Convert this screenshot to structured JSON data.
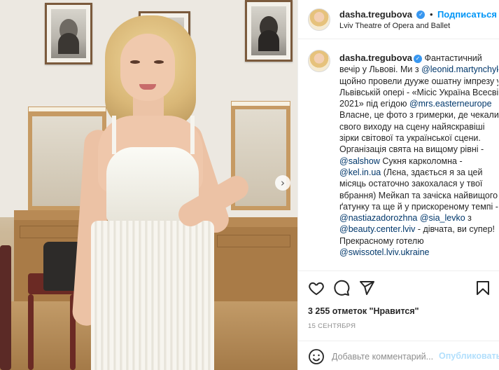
{
  "post": {
    "username": "dasha.tregubova",
    "follow_label": "Подписаться",
    "follow_separator": "•",
    "location": "Lviv Theatre of Opera and Ballet",
    "verified_icon": "verified-badge-icon",
    "accent_color": "#0095f6"
  },
  "photo": {
    "next_arrow": "›"
  },
  "caption": {
    "username": "dasha.tregubova",
    "segments": [
      {
        "text": " Фантастичний вечір у Львові. Ми з ",
        "mention": false
      },
      {
        "text": "@leonid.martynchyk",
        "mention": true
      },
      {
        "text": " щойно провели дууже ошатну імпрезу у Львівській опері - «Місіс Україна Всесвіт 2021» під егідою ",
        "mention": false
      },
      {
        "text": "@mrs.easterneurope",
        "mention": true
      },
      {
        "text": " Власне, це фото з гримерки, де чекали свого виходу на сцену найяскравіші зірки світової та української сцени. Організація свята на вищому рівні - ",
        "mention": false
      },
      {
        "text": "@salshow",
        "mention": true
      },
      {
        "text": " Сукня карколомна - ",
        "mention": false
      },
      {
        "text": "@kel.in.ua",
        "mention": true
      },
      {
        "text": " (Лєна, здається я за цей місяць остаточно закохалася у твої вбрання) Мейкап та зачіска найвищого ґатунку та ще й у прискореному темпі - ",
        "mention": false
      },
      {
        "text": "@nastiazadorozhna",
        "mention": true
      },
      {
        "text": " ",
        "mention": false
      },
      {
        "text": "@sia_levko",
        "mention": true
      },
      {
        "text": " з ",
        "mention": false
      },
      {
        "text": "@beauty.center.lviv",
        "mention": true
      },
      {
        "text": " - дівчата, ви супер! Прекрасному готелю ",
        "mention": false
      },
      {
        "text": "@swissotel.lviv.ukraine",
        "mention": true
      }
    ]
  },
  "actions": {
    "icons": [
      "heart-icon",
      "comment-icon",
      "share-icon",
      "bookmark-icon"
    ]
  },
  "likes_text": "3 255 отметок \"Нравится\"",
  "date_text": "15 СЕНТЯБРЯ",
  "comment": {
    "placeholder": "Добавьте комментарий...",
    "value": "",
    "publish_label": "Опубликовать",
    "emoji_icon": "emoji-icon"
  }
}
